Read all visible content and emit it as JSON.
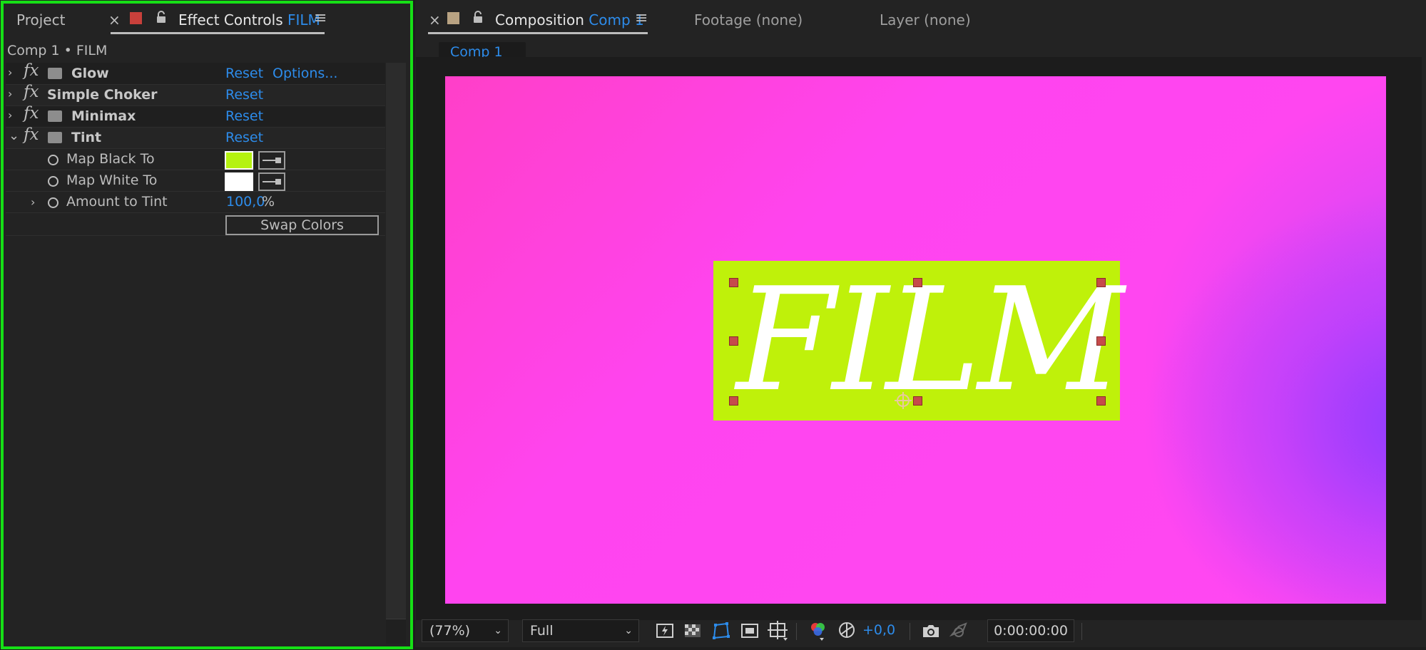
{
  "left_panel": {
    "tabs": {
      "project": "Project",
      "close_glyph": "×",
      "effect_controls": "Effect Controls",
      "effect_controls_target": "FILM",
      "menu_glyph": "≡",
      "label_color": "#c8403b"
    },
    "breadcrumb": "Comp 1 • FILM",
    "effects": [
      {
        "name": "Glow",
        "reset": "Reset",
        "options": "Options...",
        "expanded": false
      },
      {
        "name": "Simple Choker",
        "reset": "Reset",
        "expanded": false
      },
      {
        "name": "Minimax",
        "reset": "Reset",
        "expanded": false
      },
      {
        "name": "Tint",
        "reset": "Reset",
        "expanded": true
      }
    ],
    "tint_props": {
      "map_black_to": {
        "label": "Map Black To",
        "color": "#b5f211"
      },
      "map_white_to": {
        "label": "Map White To",
        "color": "#ffffff"
      },
      "amount_to_tint": {
        "label": "Amount to Tint",
        "value": "100,0",
        "unit": "%"
      },
      "swap_colors": "Swap Colors"
    },
    "highlight_color": "#16e016"
  },
  "right_panel": {
    "tabs": {
      "close_glyph": "×",
      "composition": "Composition",
      "composition_target": "Comp 1",
      "menu_glyph": "≡",
      "footage": "Footage (none)",
      "layer": "Layer (none)",
      "label_color": "#b8a282"
    },
    "comp_tab": "Comp 1",
    "canvas_text": "FILM",
    "text_box_color": "#bff10a",
    "toolbar": {
      "zoom": "(77%)",
      "resolution": "Full",
      "exposure": "+0,0",
      "timecode": "0:00:00:00"
    }
  }
}
